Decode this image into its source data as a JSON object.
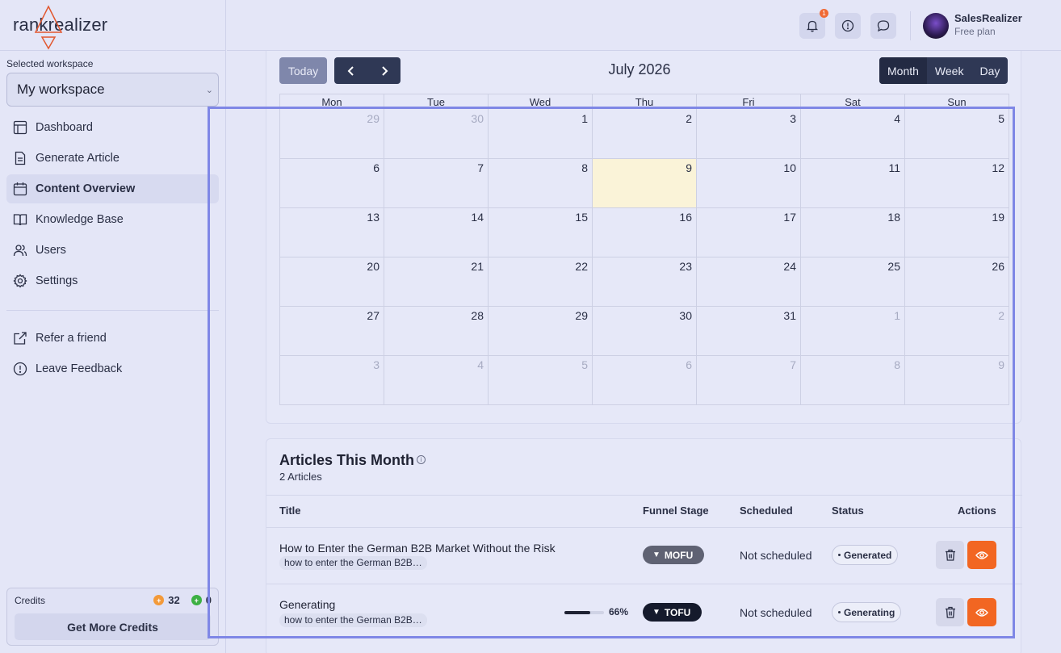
{
  "brand": {
    "name": "rankrealizer"
  },
  "workspace": {
    "label": "Selected workspace",
    "value": "My workspace"
  },
  "sidebar": {
    "items": [
      {
        "label": "Dashboard",
        "icon": "layout-icon"
      },
      {
        "label": "Generate Article",
        "icon": "document-icon"
      },
      {
        "label": "Content Overview",
        "icon": "calendar-icon",
        "active": true
      },
      {
        "label": "Knowledge Base",
        "icon": "book-icon"
      },
      {
        "label": "Users",
        "icon": "users-icon"
      },
      {
        "label": "Settings",
        "icon": "gear-icon"
      }
    ],
    "secondary": [
      {
        "label": "Refer a friend",
        "icon": "external-link-icon"
      },
      {
        "label": "Leave Feedback",
        "icon": "alert-circle-icon"
      }
    ]
  },
  "credits": {
    "label": "Credits",
    "value1": "32",
    "value2": "0",
    "button": "Get More Credits"
  },
  "topbar": {
    "notification_count": "1",
    "user_name": "SalesRealizer",
    "user_plan": "Free plan"
  },
  "calendar": {
    "today_label": "Today",
    "prev_label": "‹",
    "next_label": "›",
    "title": "July 2026",
    "views": [
      "Month",
      "Week",
      "Day"
    ],
    "active_view": "Month",
    "weekdays": [
      "Mon",
      "Tue",
      "Wed",
      "Thu",
      "Fri",
      "Sat",
      "Sun"
    ],
    "weeks": [
      [
        {
          "d": "29",
          "m": true
        },
        {
          "d": "30",
          "m": true
        },
        {
          "d": "1"
        },
        {
          "d": "2"
        },
        {
          "d": "3"
        },
        {
          "d": "4"
        },
        {
          "d": "5"
        }
      ],
      [
        {
          "d": "6"
        },
        {
          "d": "7"
        },
        {
          "d": "8"
        },
        {
          "d": "9",
          "today": true
        },
        {
          "d": "10"
        },
        {
          "d": "11"
        },
        {
          "d": "12"
        }
      ],
      [
        {
          "d": "13"
        },
        {
          "d": "14"
        },
        {
          "d": "15"
        },
        {
          "d": "16"
        },
        {
          "d": "17"
        },
        {
          "d": "18"
        },
        {
          "d": "19"
        }
      ],
      [
        {
          "d": "20"
        },
        {
          "d": "21"
        },
        {
          "d": "22"
        },
        {
          "d": "23"
        },
        {
          "d": "24"
        },
        {
          "d": "25"
        },
        {
          "d": "26"
        }
      ],
      [
        {
          "d": "27"
        },
        {
          "d": "28"
        },
        {
          "d": "29"
        },
        {
          "d": "30"
        },
        {
          "d": "31"
        },
        {
          "d": "1",
          "m": true
        },
        {
          "d": "2",
          "m": true
        }
      ],
      [
        {
          "d": "3",
          "m": true
        },
        {
          "d": "4",
          "m": true
        },
        {
          "d": "5",
          "m": true
        },
        {
          "d": "6",
          "m": true
        },
        {
          "d": "7",
          "m": true
        },
        {
          "d": "8",
          "m": true
        },
        {
          "d": "9",
          "m": true
        }
      ]
    ]
  },
  "articles": {
    "title": "Articles This Month",
    "count": "2 Articles",
    "columns": {
      "title": "Title",
      "funnel": "Funnel Stage",
      "scheduled": "Scheduled",
      "status": "Status",
      "actions": "Actions"
    },
    "rows": [
      {
        "title": "How to Enter the German B2B Market Without the Risk",
        "keyword": "how to enter the German B2B…",
        "funnel": "MOFU",
        "funnel_color": "#5f6273",
        "scheduled": "Not scheduled",
        "status": "Generated"
      },
      {
        "title": "Generating",
        "keyword": "how to enter the German B2B…",
        "progress": "66%",
        "progress_fraction": 0.66,
        "funnel": "TOFU",
        "funnel_color": "#151a2c",
        "scheduled": "Not scheduled",
        "status": "Generating"
      }
    ]
  },
  "colors": {
    "accent": "#f26622",
    "nav_dark": "#2f3855",
    "today_bg": "#faf3d8"
  }
}
